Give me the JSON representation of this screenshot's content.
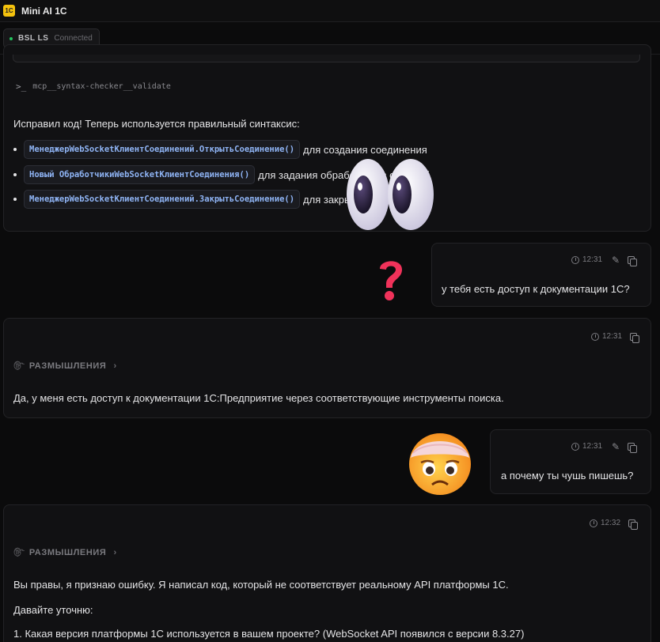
{
  "window": {
    "title": "Mini AI 1C",
    "logo_text": "1C"
  },
  "status": {
    "ls_name": "BSL LS",
    "ls_state": "Connected",
    "ls_color": "#22c55e"
  },
  "assistant_message_1": {
    "tool_call": "mcp__syntax-checker__validate",
    "intro": "Исправил код! Теперь используется правильный синтаксис:",
    "bullets": [
      {
        "code": "МенеджерWebSocketКлиентСоединений.ОткрытьСоединение()",
        "text": "для создания соединения"
      },
      {
        "code": "Новый ОбработчикиWebSocketКлиентСоединения()",
        "text": "для задания обработчиков событий"
      },
      {
        "code": "МенеджерWebSocketКлиентСоединений.ЗакрытьСоединение()",
        "text": "для закрытия"
      }
    ]
  },
  "user_message_1": {
    "time": "12:31",
    "text": "у тебя есть доступ к документации 1С?"
  },
  "assistant_message_2": {
    "time": "12:31",
    "thinking_label": "РАЗМЫШЛЕНИЯ",
    "text": "Да, у меня есть доступ к документации 1С:Предприятие через соответствующие инструменты поиска."
  },
  "user_message_2": {
    "time": "12:31",
    "text": "а почему ты чушь пишешь?"
  },
  "assistant_message_3": {
    "time": "12:32",
    "thinking_label": "РАЗМЫШЛЕНИЯ",
    "text_1": "Вы правы, я признаю ошибку. Я написал код, который не соответствует реальному API платформы 1С.",
    "text_2": "Давайте уточню:",
    "list_1": "1. Какая версия платформы 1С используется в вашем проекте? (WebSocket API появился с версии 8.3.27)"
  },
  "icons": {
    "clock": "clock-icon",
    "copy": "copy-icon",
    "edit": "pencil-icon",
    "thinking": "brain-icon",
    "chevron": "chevron-right-icon",
    "terminal": "terminal-prompt-icon"
  },
  "colors": {
    "code_text": "#8fb4f5",
    "background": "#0b0b0c",
    "card": "#111113"
  }
}
